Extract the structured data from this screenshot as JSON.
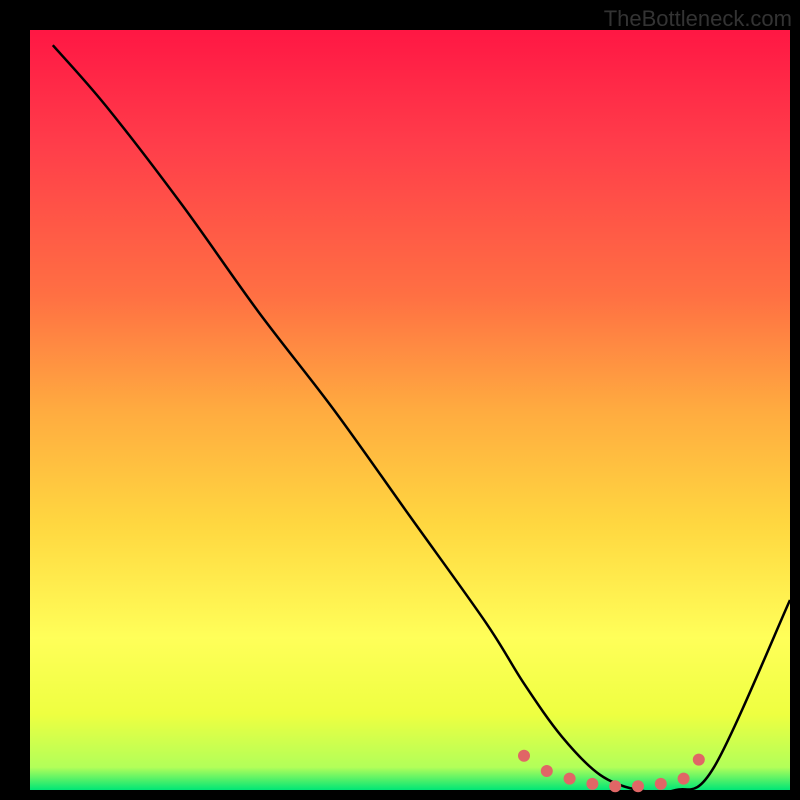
{
  "watermark": "TheBottleneck.com",
  "chart_data": {
    "type": "line",
    "title": "",
    "xlabel": "",
    "ylabel": "",
    "xlim": [
      0,
      100
    ],
    "ylim": [
      0,
      100
    ],
    "x": [
      3,
      10,
      20,
      30,
      40,
      50,
      60,
      65,
      70,
      75,
      80,
      85,
      90,
      100
    ],
    "values": [
      98,
      90,
      77,
      63,
      50,
      36,
      22,
      14,
      7,
      2,
      0,
      0,
      3,
      25
    ],
    "optimal_zone": {
      "x": [
        65,
        68,
        71,
        74,
        77,
        80,
        83,
        86,
        88
      ],
      "values": [
        4.5,
        2.5,
        1.5,
        0.8,
        0.5,
        0.5,
        0.8,
        1.5,
        4
      ]
    },
    "gradient_stops": [
      {
        "offset": 0,
        "color": "#ff1744"
      },
      {
        "offset": 15,
        "color": "#ff3d4a"
      },
      {
        "offset": 35,
        "color": "#ff7043"
      },
      {
        "offset": 50,
        "color": "#ffab40"
      },
      {
        "offset": 65,
        "color": "#ffd740"
      },
      {
        "offset": 80,
        "color": "#ffff59"
      },
      {
        "offset": 90,
        "color": "#eeff41"
      },
      {
        "offset": 97,
        "color": "#b2ff59"
      },
      {
        "offset": 100,
        "color": "#00e676"
      }
    ],
    "curve_color": "#000000",
    "marker_color": "#e06666",
    "background": "#000000"
  }
}
